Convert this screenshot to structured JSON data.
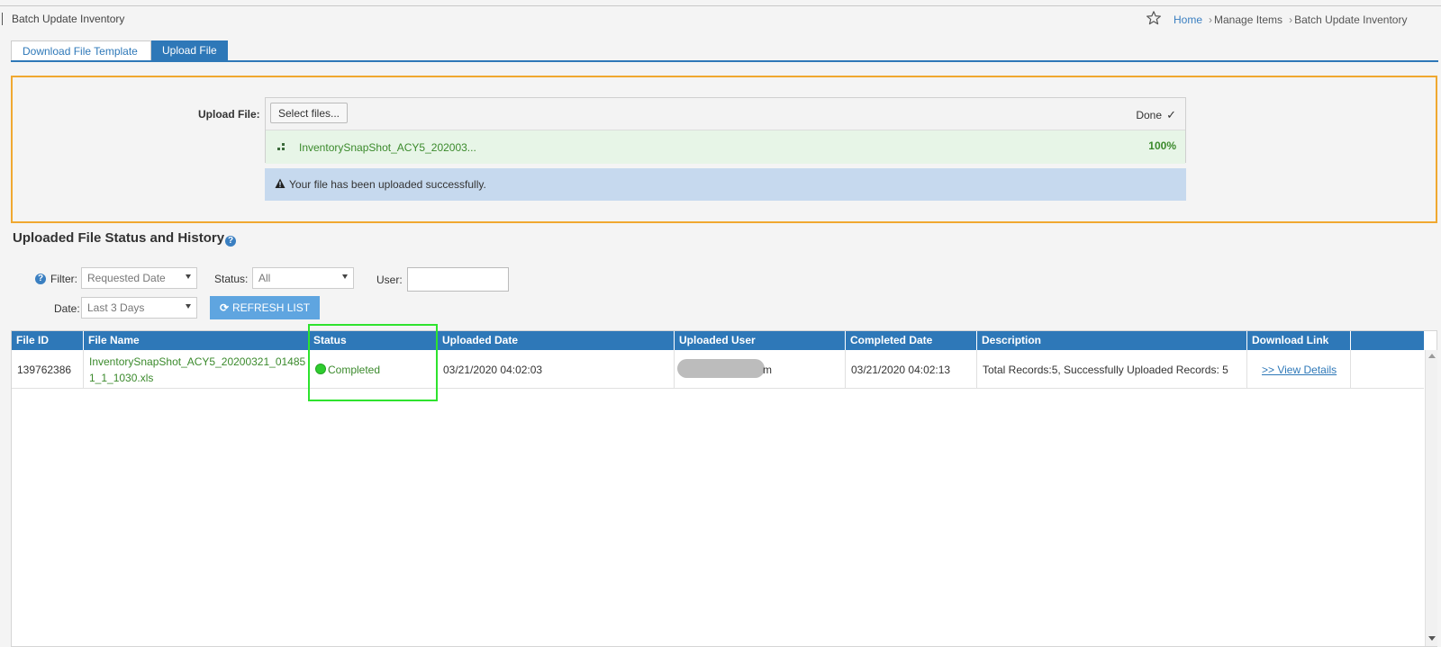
{
  "header": {
    "title": "Batch Update Inventory",
    "breadcrumb": [
      "Home",
      "Manage Items",
      "Batch Update Inventory"
    ]
  },
  "tabs": [
    {
      "label": "Download File Template",
      "active": false
    },
    {
      "label": "Upload File",
      "active": true
    }
  ],
  "upload": {
    "label": "Upload File:",
    "select_button": "Select files...",
    "status": "Done",
    "file_name": "InventorySnapShot_ACY5_202003...",
    "progress": "100%",
    "message": "Your file has been uploaded successfully."
  },
  "history": {
    "title": "Uploaded File Status and History",
    "filters": {
      "filter_label": "Filter:",
      "filter_value": "Requested Date",
      "status_label": "Status:",
      "status_value": "All",
      "user_label": "User:",
      "user_value": "",
      "date_label": "Date:",
      "date_value": "Last 3 Days",
      "refresh_button": "REFRESH LIST"
    },
    "columns": [
      "File ID",
      "File Name",
      "Status",
      "Uploaded Date",
      "Uploaded User",
      "Completed Date",
      "Description",
      "Download Link"
    ],
    "rows": [
      {
        "file_id": "139762386",
        "file_name_line1": "InventorySnapShot_ACY5_20200321_01485",
        "file_name_line2": "1_1_1030.xls",
        "status": "Completed",
        "uploaded_date": "03/21/2020 04:02:03",
        "uploaded_user_tail": "m",
        "completed_date": "03/21/2020 04:02:13",
        "description": "Total Records:5, Successfully Uploaded Records: 5",
        "download_link": ">> View Details"
      }
    ]
  },
  "colors": {
    "primary": "#2e78b8",
    "upload_border": "#f0a830",
    "success_green": "#3b8a2c",
    "highlight": "#2ee32e",
    "message_bg": "#c6d9ee"
  }
}
